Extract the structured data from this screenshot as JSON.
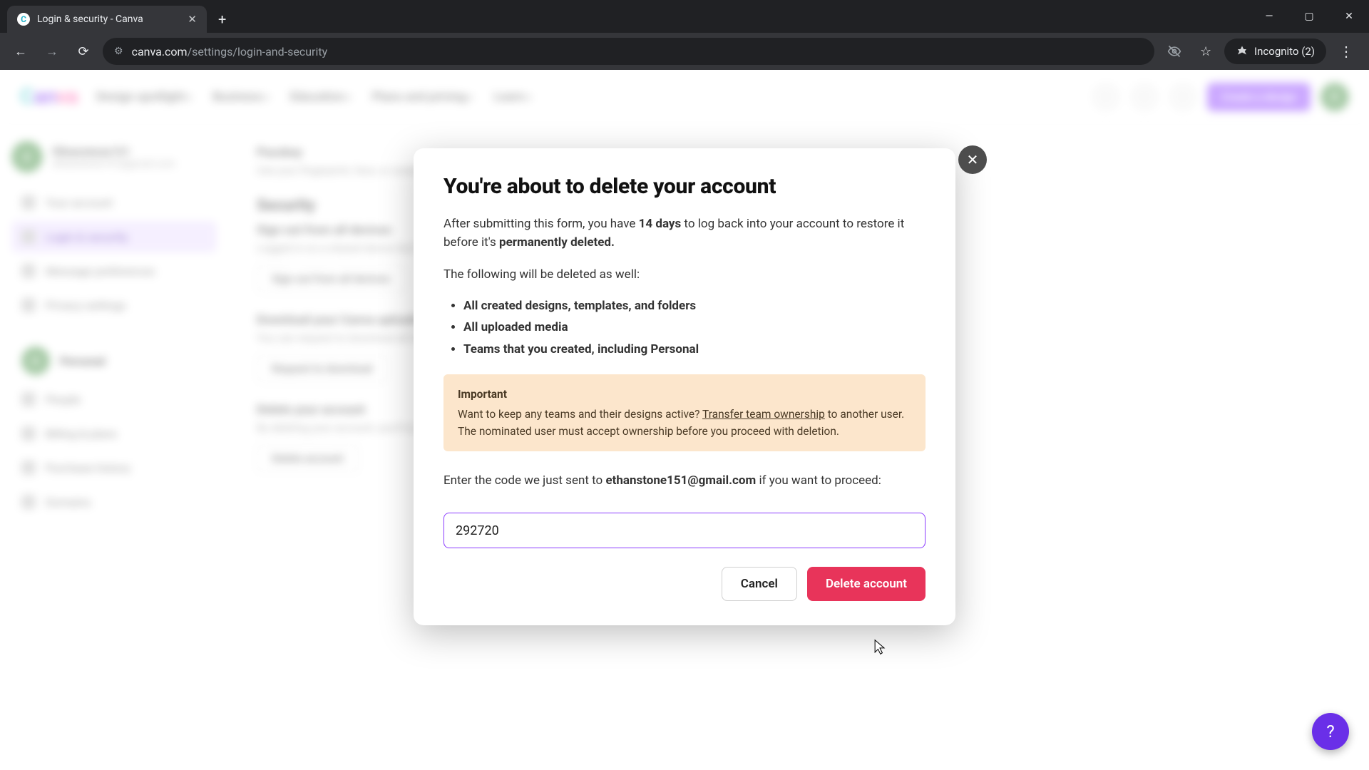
{
  "browser": {
    "tab_title": "Login & security - Canva",
    "url_host": "canva.com",
    "url_path": "/settings/login-and-security",
    "incognito_label": "Incognito (2)"
  },
  "header": {
    "nav": [
      "Design spotlight",
      "Business",
      "Education",
      "Plans and pricing",
      "Learn"
    ],
    "cta": "Create a design",
    "avatar_initial": "E"
  },
  "sidebar": {
    "user_name": "Ethanstone151",
    "user_email": "ethanstone151@gmail.com",
    "items": [
      {
        "label": "Your account"
      },
      {
        "label": "Login & security"
      },
      {
        "label": "Message preferences"
      },
      {
        "label": "Privacy settings"
      }
    ],
    "team_name": "Personal",
    "team_items": [
      "People",
      "Billing & plans",
      "Purchase history",
      "Domains"
    ]
  },
  "content": {
    "passkey_title": "Passkey",
    "passkey_desc": "Use your fingerprint, face, or screen lock to sign in. Passkeys are a simple and secure alternative to passwords.",
    "security_title": "Security",
    "signout_title": "Sign out from all devices",
    "signout_desc": "Logged in on a shared device but forgot to sign out? End all sessions by signing out from all devices.",
    "signout_btn": "Sign out from all devices",
    "download_title": "Download your Canva uploads",
    "download_desc": "You can request to download all the media you've uploaded to Canva.",
    "download_btn": "Request to download",
    "delete_title": "Delete your account",
    "delete_desc": "By deleting your account, you'll no longer be able to access any of your designs or log in to Canva. Your account may remain available for 14 days.",
    "delete_btn": "Delete account"
  },
  "modal": {
    "title": "You're about to delete your account",
    "para1_pre": "After submitting this form, you have ",
    "para1_bold1": "14 days",
    "para1_mid": " to log back into your account to restore it before it's ",
    "para1_bold2": "permanently deleted.",
    "list_intro": "The following will be deleted as well:",
    "list": [
      "All created designs, templates, and folders",
      "All uploaded media",
      "Teams that you created, including Personal"
    ],
    "notice_title": "Important",
    "notice_pre": "Want to keep any teams and their designs active? ",
    "notice_link": "Transfer team ownership",
    "notice_post": " to another user. The nominated user must accept ownership before you proceed with deletion.",
    "code_pre": "Enter the code we just sent to ",
    "code_email": "ethanstone151@gmail.com",
    "code_post": " if you want to proceed:",
    "code_value": "292720",
    "cancel": "Cancel",
    "confirm": "Delete account"
  }
}
